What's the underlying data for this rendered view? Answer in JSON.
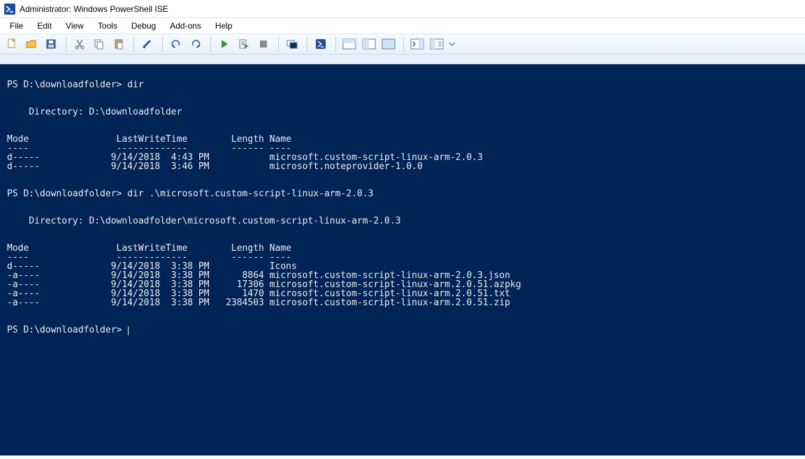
{
  "title": "Administrator: Windows PowerShell ISE",
  "menu": {
    "file": "File",
    "edit": "Edit",
    "view": "View",
    "tools": "Tools",
    "debug": "Debug",
    "addons": "Add-ons",
    "help": "Help"
  },
  "toolbar_icons": {
    "new": "new-icon",
    "open": "open-icon",
    "save": "save-icon",
    "cut": "cut-icon",
    "copy": "copy-icon",
    "paste": "paste-icon",
    "clear": "clear-icon",
    "undo": "undo-icon",
    "redo": "redo-icon",
    "run": "run-icon",
    "run_selection": "run-selection-icon",
    "stop": "stop-icon",
    "remote": "remote-icon",
    "powershell": "powershell-icon",
    "layout1": "layout1-icon",
    "layout2": "layout2-icon",
    "layout3": "layout3-icon",
    "show_script": "show-script-icon",
    "show_command": "show-command-icon",
    "dropdown": "dropdown-icon"
  },
  "console": {
    "prompt": "PS D:\\downloadfolder>",
    "cmd1": "dir",
    "dir1_header": "    Directory: D:\\downloadfolder",
    "cols": {
      "mode": "Mode",
      "lwt": "LastWriteTime",
      "length": "Length",
      "name": "Name"
    },
    "dash": {
      "mode": "----",
      "lwt": "-------------",
      "length": "------",
      "name": "----"
    },
    "listing1": [
      {
        "mode": "d-----",
        "date": "9/14/2018",
        "time": "4:43 PM",
        "length": "",
        "name": "microsoft.custom-script-linux-arm-2.0.3"
      },
      {
        "mode": "d-----",
        "date": "9/14/2018",
        "time": "3:46 PM",
        "length": "",
        "name": "microsoft.noteprovider-1.0.0"
      }
    ],
    "cmd2": "dir .\\microsoft.custom-script-linux-arm-2.0.3",
    "dir2_header": "    Directory: D:\\downloadfolder\\microsoft.custom-script-linux-arm-2.0.3",
    "listing2": [
      {
        "mode": "d-----",
        "date": "9/14/2018",
        "time": "3:38 PM",
        "length": "",
        "name": "Icons"
      },
      {
        "mode": "-a----",
        "date": "9/14/2018",
        "time": "3:38 PM",
        "length": "8864",
        "name": "microsoft.custom-script-linux-arm-2.0.3.json"
      },
      {
        "mode": "-a----",
        "date": "9/14/2018",
        "time": "3:38 PM",
        "length": "17306",
        "name": "microsoft.custom-script-linux-arm.2.0.51.azpkg"
      },
      {
        "mode": "-a----",
        "date": "9/14/2018",
        "time": "3:38 PM",
        "length": "1470",
        "name": "microsoft.custom-script-linux-arm.2.0.51.txt"
      },
      {
        "mode": "-a----",
        "date": "9/14/2018",
        "time": "3:38 PM",
        "length": "2384503",
        "name": "microsoft.custom-script-linux-arm.2.0.51.zip"
      }
    ]
  }
}
